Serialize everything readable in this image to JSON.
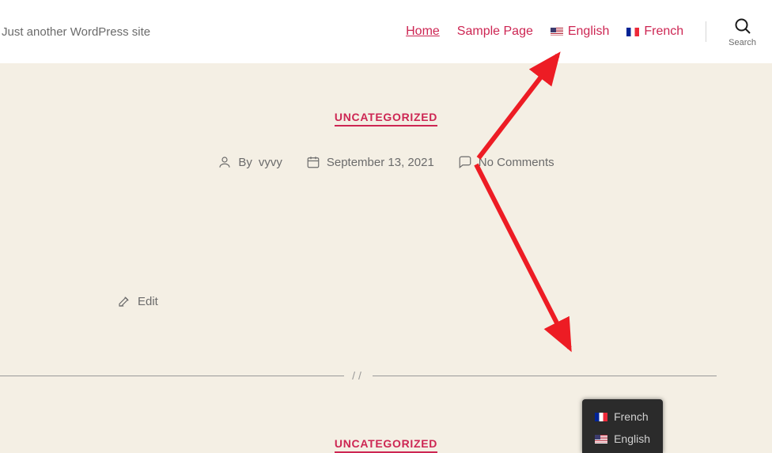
{
  "header": {
    "tagline": "Just another WordPress site",
    "nav": [
      {
        "label": "Home",
        "active": true
      },
      {
        "label": "Sample Page",
        "active": false
      },
      {
        "label": "English",
        "flag": "us",
        "active": false
      },
      {
        "label": "French",
        "flag": "fr",
        "active": false
      }
    ],
    "search_label": "Search"
  },
  "posts": [
    {
      "category": "UNCATEGORIZED",
      "author_prefix": "By ",
      "author": "vyvy",
      "date": "September 13, 2021",
      "comments": "No Comments",
      "edit": "Edit"
    },
    {
      "category": "UNCATEGORIZED"
    }
  ],
  "lang_widget": {
    "items": [
      {
        "label": "French",
        "flag": "fr"
      },
      {
        "label": "English",
        "flag": "us"
      }
    ]
  },
  "colors": {
    "accent": "#cd2653",
    "muted": "#6b6b6b",
    "content_bg": "#f4efe4",
    "annotation": "#ed1c24"
  }
}
